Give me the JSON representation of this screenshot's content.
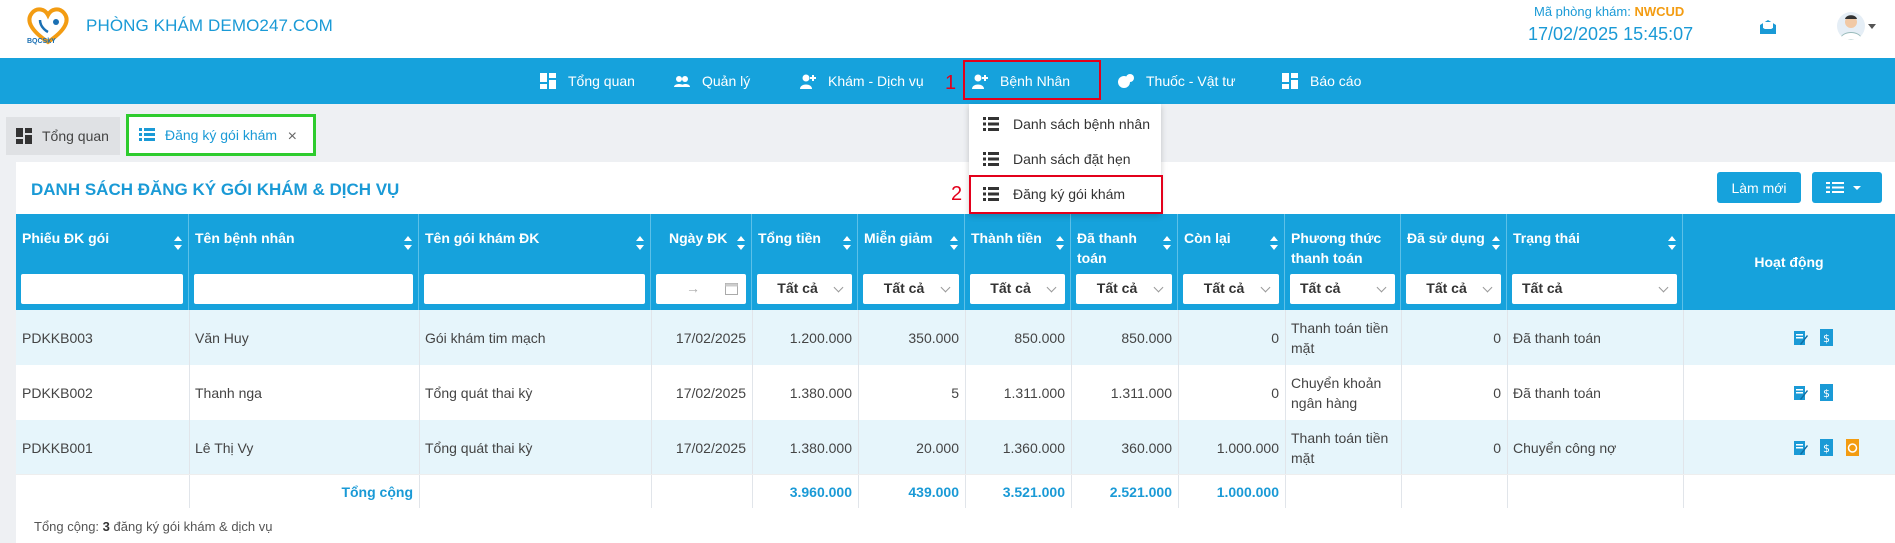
{
  "header": {
    "brand": "PHÒNG KHÁM DEMO247.COM",
    "logo_text": "BQCSkY",
    "clinic_code_label": "Mã phòng khám:",
    "clinic_code": "NWCUD",
    "datetime": "17/02/2025 15:45:07"
  },
  "nav": {
    "items": [
      {
        "label": "Tổng quan"
      },
      {
        "label": "Quản lý"
      },
      {
        "label": "Khám - Dịch vụ"
      },
      {
        "label": "Bệnh Nhân"
      },
      {
        "label": "Thuốc - Vật tư"
      },
      {
        "label": "Báo cáo"
      }
    ],
    "dropdown": [
      "Danh sách bệnh nhân",
      "Danh sách đặt hẹn",
      "Đăng ký gói khám"
    ]
  },
  "annotations": {
    "step1": "1",
    "step2": "2"
  },
  "tabs": [
    {
      "label": "Tổng quan"
    },
    {
      "label": "Đăng ký gói khám"
    }
  ],
  "page": {
    "title": "DANH SÁCH ĐĂNG KÝ GÓI KHÁM & DỊCH VỤ",
    "refresh_label": "Làm mới"
  },
  "table": {
    "columns": [
      {
        "label": "Phiếu ĐK gói"
      },
      {
        "label": "Tên bệnh nhân"
      },
      {
        "label": "Tên gói khám ĐK"
      },
      {
        "label": "Ngày ĐK"
      },
      {
        "label": "Tổng tiền"
      },
      {
        "label": "Miễn giảm"
      },
      {
        "label": "Thành tiền"
      },
      {
        "label": "Đã thanh toán"
      },
      {
        "label": "Còn lại"
      },
      {
        "label": "Phương thức thanh toán"
      },
      {
        "label": "Đã sử dụng"
      },
      {
        "label": "Trạng thái"
      },
      {
        "label": "Hoạt động"
      }
    ],
    "filter_all": "Tất cả",
    "date_range_arrow": "→",
    "rows": [
      {
        "code": "PDKKB003",
        "patient": "Văn Huy",
        "package": "Gói khám tim mạch",
        "date": "17/02/2025",
        "total": "1.200.000",
        "discount": "350.000",
        "amount": "850.000",
        "paid": "850.000",
        "remaining": "0",
        "method": "Thanh toán tiền mặt",
        "used": "0",
        "status": "Đã thanh toán"
      },
      {
        "code": "PDKKB002",
        "patient": "Thanh nga",
        "package": "Tổng quát thai kỳ",
        "date": "17/02/2025",
        "total": "1.380.000",
        "discount": "5",
        "amount": "1.311.000",
        "paid": "1.311.000",
        "remaining": "0",
        "method": "Chuyển khoản ngân hàng",
        "used": "0",
        "status": "Đã thanh toán"
      },
      {
        "code": "PDKKB001",
        "patient": "Lê Thị Vy",
        "package": "Tổng quát thai kỳ",
        "date": "17/02/2025",
        "total": "1.380.000",
        "discount": "20.000",
        "amount": "1.360.000",
        "paid": "360.000",
        "remaining": "1.000.000",
        "method": "Thanh toán tiền mặt",
        "used": "0",
        "status": "Chuyển công nợ"
      }
    ],
    "totals": {
      "label": "Tổng cộng",
      "total": "3.960.000",
      "discount": "439.000",
      "amount": "3.521.000",
      "paid": "2.521.000",
      "remaining": "1.000.000"
    },
    "footer": {
      "prefix": "Tổng cộng:",
      "count": "3",
      "suffix": "đăng ký gói khám & dịch vụ"
    }
  },
  "colors": {
    "primary": "#16a2dc",
    "highlight_red": "#e3001b",
    "highlight_green": "#2ecc2e",
    "accent_orange": "#f39c12"
  }
}
